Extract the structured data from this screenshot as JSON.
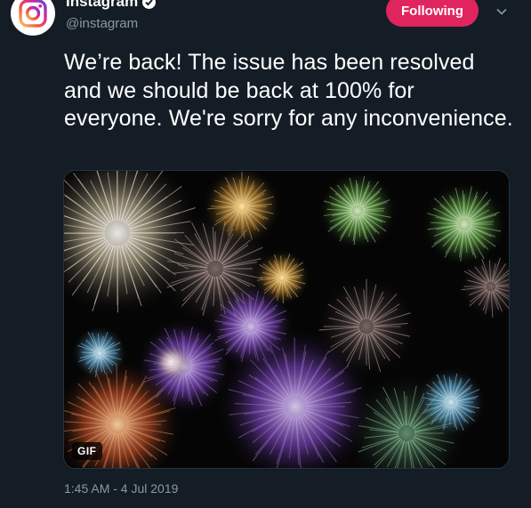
{
  "author": {
    "name": "Instagram",
    "handle": "@instagram",
    "verified": true
  },
  "follow_button": {
    "label": "Following"
  },
  "tweet": {
    "text": "We’re back! The issue has been resolved and we should be back at 100% for everyone. We're sorry for any inconvenience.",
    "timestamp": "1:45 AM - 4 Jul 2019"
  },
  "media": {
    "type": "gif",
    "badge": "GIF"
  },
  "colors": {
    "background": "#141d26",
    "follow_button": "#e0245e",
    "secondary_text": "#8899a6"
  },
  "icons": {
    "avatar": "instagram-logo-icon",
    "verified": "verified-badge-icon",
    "menu": "chevron-down-icon"
  }
}
